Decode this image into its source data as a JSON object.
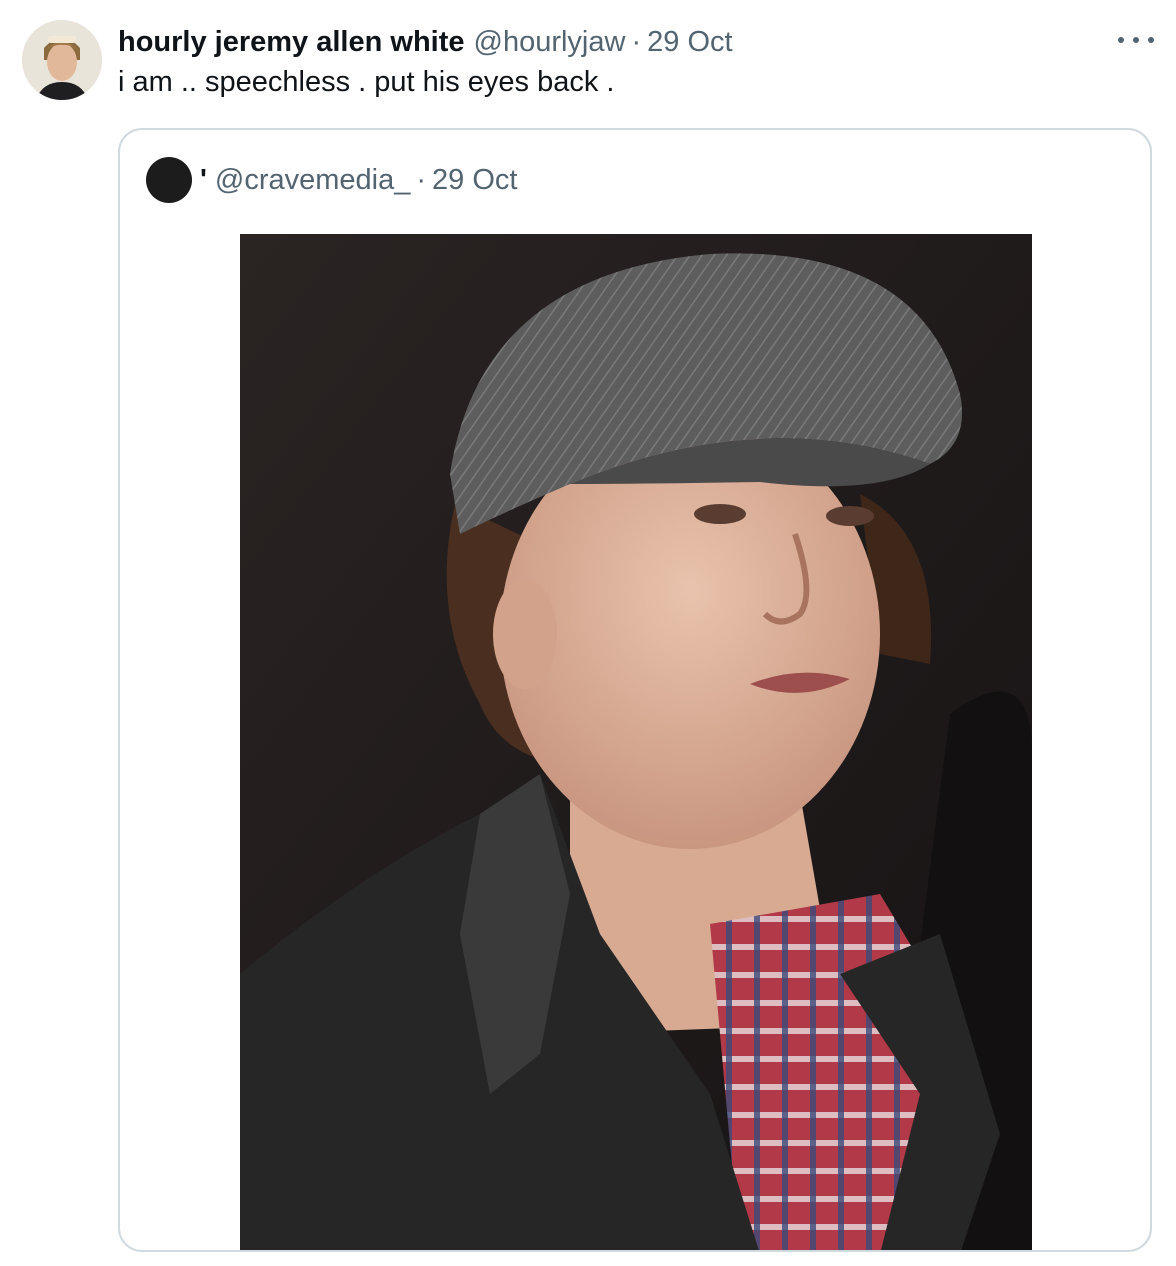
{
  "tweet": {
    "author_name": "hourly jeremy allen white",
    "author_handle": "@hourlyjaw",
    "separator": "·",
    "timestamp": "29 Oct",
    "text": "i am .. speechless . put his eyes back .",
    "more_icon": "more-horizontal-icon"
  },
  "quoted_tweet": {
    "author_name": "'",
    "author_handle": "@cravemedia_",
    "separator": "·",
    "timestamp": "29 Oct",
    "media_icon": "photo"
  },
  "colors": {
    "text_primary": "#0f1419",
    "text_secondary": "#536471",
    "border": "#cfd9de"
  }
}
